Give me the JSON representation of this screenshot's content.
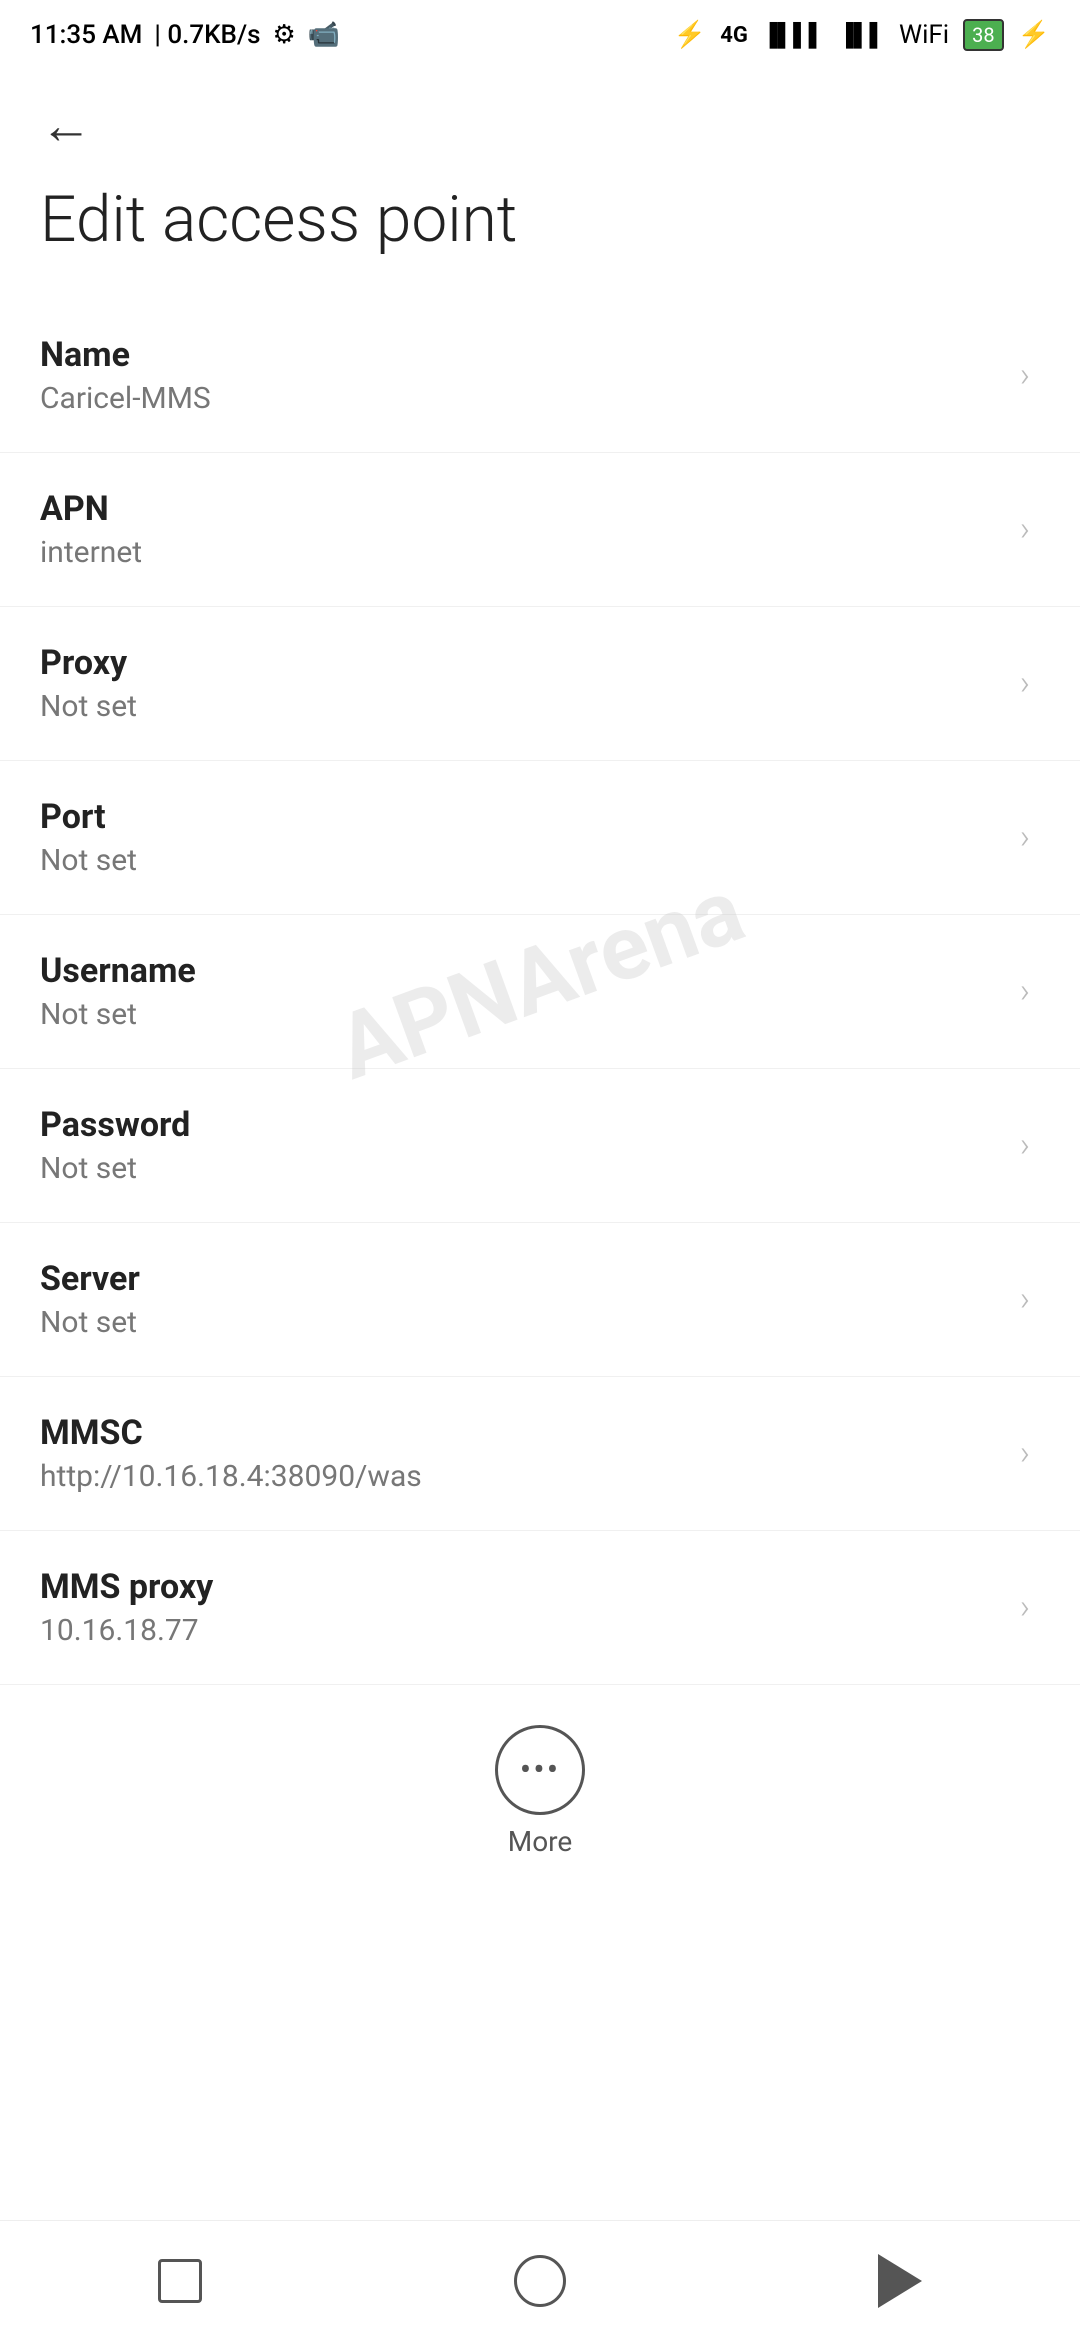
{
  "statusBar": {
    "time": "11:35 AM",
    "speed": "0.7KB/s",
    "battery": "38",
    "batterySymbol": "⚡"
  },
  "header": {
    "backLabel": "←"
  },
  "pageTitle": "Edit access point",
  "settingsItems": [
    {
      "label": "Name",
      "value": "Caricel-MMS"
    },
    {
      "label": "APN",
      "value": "internet"
    },
    {
      "label": "Proxy",
      "value": "Not set"
    },
    {
      "label": "Port",
      "value": "Not set"
    },
    {
      "label": "Username",
      "value": "Not set"
    },
    {
      "label": "Password",
      "value": "Not set"
    },
    {
      "label": "Server",
      "value": "Not set"
    },
    {
      "label": "MMSC",
      "value": "http://10.16.18.4:38090/was"
    },
    {
      "label": "MMS proxy",
      "value": "10.16.18.77"
    }
  ],
  "more": {
    "label": "More"
  },
  "watermark": {
    "line1": "APNArena"
  }
}
